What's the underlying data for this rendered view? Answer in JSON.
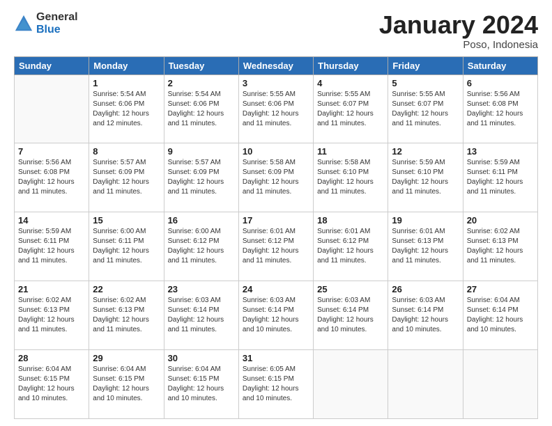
{
  "logo": {
    "general": "General",
    "blue": "Blue"
  },
  "title": {
    "month_year": "January 2024",
    "location": "Poso, Indonesia"
  },
  "header": {
    "days": [
      "Sunday",
      "Monday",
      "Tuesday",
      "Wednesday",
      "Thursday",
      "Friday",
      "Saturday"
    ]
  },
  "weeks": [
    [
      {
        "num": "",
        "info": ""
      },
      {
        "num": "1",
        "info": "Sunrise: 5:54 AM\nSunset: 6:06 PM\nDaylight: 12 hours\nand 12 minutes."
      },
      {
        "num": "2",
        "info": "Sunrise: 5:54 AM\nSunset: 6:06 PM\nDaylight: 12 hours\nand 11 minutes."
      },
      {
        "num": "3",
        "info": "Sunrise: 5:55 AM\nSunset: 6:06 PM\nDaylight: 12 hours\nand 11 minutes."
      },
      {
        "num": "4",
        "info": "Sunrise: 5:55 AM\nSunset: 6:07 PM\nDaylight: 12 hours\nand 11 minutes."
      },
      {
        "num": "5",
        "info": "Sunrise: 5:55 AM\nSunset: 6:07 PM\nDaylight: 12 hours\nand 11 minutes."
      },
      {
        "num": "6",
        "info": "Sunrise: 5:56 AM\nSunset: 6:08 PM\nDaylight: 12 hours\nand 11 minutes."
      }
    ],
    [
      {
        "num": "7",
        "info": "Sunrise: 5:56 AM\nSunset: 6:08 PM\nDaylight: 12 hours\nand 11 minutes."
      },
      {
        "num": "8",
        "info": "Sunrise: 5:57 AM\nSunset: 6:09 PM\nDaylight: 12 hours\nand 11 minutes."
      },
      {
        "num": "9",
        "info": "Sunrise: 5:57 AM\nSunset: 6:09 PM\nDaylight: 12 hours\nand 11 minutes."
      },
      {
        "num": "10",
        "info": "Sunrise: 5:58 AM\nSunset: 6:09 PM\nDaylight: 12 hours\nand 11 minutes."
      },
      {
        "num": "11",
        "info": "Sunrise: 5:58 AM\nSunset: 6:10 PM\nDaylight: 12 hours\nand 11 minutes."
      },
      {
        "num": "12",
        "info": "Sunrise: 5:59 AM\nSunset: 6:10 PM\nDaylight: 12 hours\nand 11 minutes."
      },
      {
        "num": "13",
        "info": "Sunrise: 5:59 AM\nSunset: 6:11 PM\nDaylight: 12 hours\nand 11 minutes."
      }
    ],
    [
      {
        "num": "14",
        "info": "Sunrise: 5:59 AM\nSunset: 6:11 PM\nDaylight: 12 hours\nand 11 minutes."
      },
      {
        "num": "15",
        "info": "Sunrise: 6:00 AM\nSunset: 6:11 PM\nDaylight: 12 hours\nand 11 minutes."
      },
      {
        "num": "16",
        "info": "Sunrise: 6:00 AM\nSunset: 6:12 PM\nDaylight: 12 hours\nand 11 minutes."
      },
      {
        "num": "17",
        "info": "Sunrise: 6:01 AM\nSunset: 6:12 PM\nDaylight: 12 hours\nand 11 minutes."
      },
      {
        "num": "18",
        "info": "Sunrise: 6:01 AM\nSunset: 6:12 PM\nDaylight: 12 hours\nand 11 minutes."
      },
      {
        "num": "19",
        "info": "Sunrise: 6:01 AM\nSunset: 6:13 PM\nDaylight: 12 hours\nand 11 minutes."
      },
      {
        "num": "20",
        "info": "Sunrise: 6:02 AM\nSunset: 6:13 PM\nDaylight: 12 hours\nand 11 minutes."
      }
    ],
    [
      {
        "num": "21",
        "info": "Sunrise: 6:02 AM\nSunset: 6:13 PM\nDaylight: 12 hours\nand 11 minutes."
      },
      {
        "num": "22",
        "info": "Sunrise: 6:02 AM\nSunset: 6:13 PM\nDaylight: 12 hours\nand 11 minutes."
      },
      {
        "num": "23",
        "info": "Sunrise: 6:03 AM\nSunset: 6:14 PM\nDaylight: 12 hours\nand 11 minutes."
      },
      {
        "num": "24",
        "info": "Sunrise: 6:03 AM\nSunset: 6:14 PM\nDaylight: 12 hours\nand 10 minutes."
      },
      {
        "num": "25",
        "info": "Sunrise: 6:03 AM\nSunset: 6:14 PM\nDaylight: 12 hours\nand 10 minutes."
      },
      {
        "num": "26",
        "info": "Sunrise: 6:03 AM\nSunset: 6:14 PM\nDaylight: 12 hours\nand 10 minutes."
      },
      {
        "num": "27",
        "info": "Sunrise: 6:04 AM\nSunset: 6:14 PM\nDaylight: 12 hours\nand 10 minutes."
      }
    ],
    [
      {
        "num": "28",
        "info": "Sunrise: 6:04 AM\nSunset: 6:15 PM\nDaylight: 12 hours\nand 10 minutes."
      },
      {
        "num": "29",
        "info": "Sunrise: 6:04 AM\nSunset: 6:15 PM\nDaylight: 12 hours\nand 10 minutes."
      },
      {
        "num": "30",
        "info": "Sunrise: 6:04 AM\nSunset: 6:15 PM\nDaylight: 12 hours\nand 10 minutes."
      },
      {
        "num": "31",
        "info": "Sunrise: 6:05 AM\nSunset: 6:15 PM\nDaylight: 12 hours\nand 10 minutes."
      },
      {
        "num": "",
        "info": ""
      },
      {
        "num": "",
        "info": ""
      },
      {
        "num": "",
        "info": ""
      }
    ]
  ]
}
